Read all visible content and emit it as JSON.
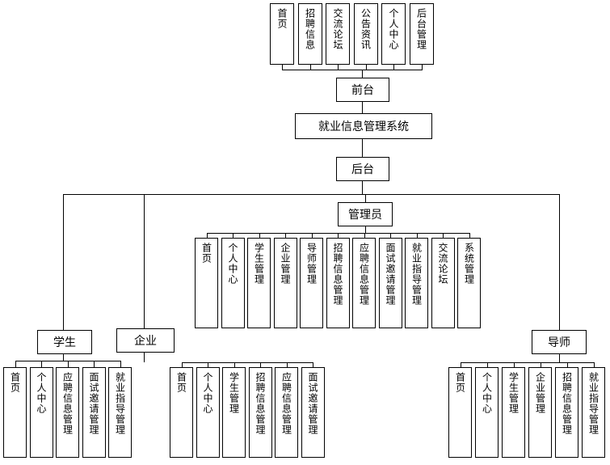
{
  "diagram": {
    "title": "就业信息管理系统",
    "frontend": {
      "label": "前台",
      "modules": [
        "首页",
        "招聘信息",
        "交流论坛",
        "公告资讯",
        "个人中心",
        "后台管理"
      ]
    },
    "backend": {
      "label": "后台",
      "admin": {
        "label": "管理员",
        "modules": [
          "首页",
          "个人中心",
          "学生管理",
          "企业管理",
          "导师管理",
          "招聘信息管理",
          "应聘信息管理",
          "面试邀请管理",
          "就业指导管理",
          "交流论坛",
          "系统管理"
        ]
      },
      "student": {
        "label": "学生",
        "modules": [
          "首页",
          "个人中心",
          "应聘信息管理",
          "面试邀请管理",
          "就业指导管理"
        ]
      },
      "company": {
        "label": "企业",
        "modules": [
          "首页",
          "个人中心",
          "学生管理",
          "招聘信息管理",
          "应聘信息管理",
          "面试邀请管理"
        ]
      },
      "mentor": {
        "label": "导师",
        "modules": [
          "首页",
          "个人中心",
          "学生管理",
          "企业管理",
          "招聘信息管理",
          "就业指导管理"
        ]
      }
    }
  }
}
